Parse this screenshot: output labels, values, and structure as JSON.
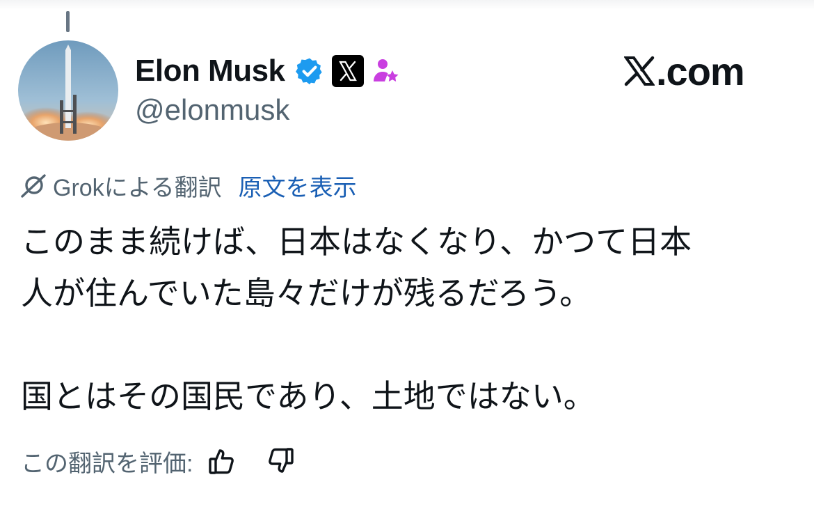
{
  "author": {
    "display_name": "Elon Musk",
    "handle": "@elonmusk",
    "badges": [
      "verified-badge-icon",
      "x-affiliate-icon",
      "subscriber-icon"
    ],
    "verified_color": "#1d9bf0",
    "subscriber_color": "#c93fe0"
  },
  "watermark": {
    "text": ".com"
  },
  "translation": {
    "label": "Grokによる翻訳",
    "show_original": "原文を表示",
    "link_color": "#1a5fb4"
  },
  "tweet": {
    "lines": [
      "このまま続けば、日本はなくなり、かつて日本",
      "人が住んでいた島々だけが残るだろう。",
      "国とはその国民であり、土地ではない。"
    ]
  },
  "rating": {
    "label": "この翻訳を評価:",
    "up_icon": "thumbs-up-icon",
    "down_icon": "thumbs-down-icon"
  }
}
